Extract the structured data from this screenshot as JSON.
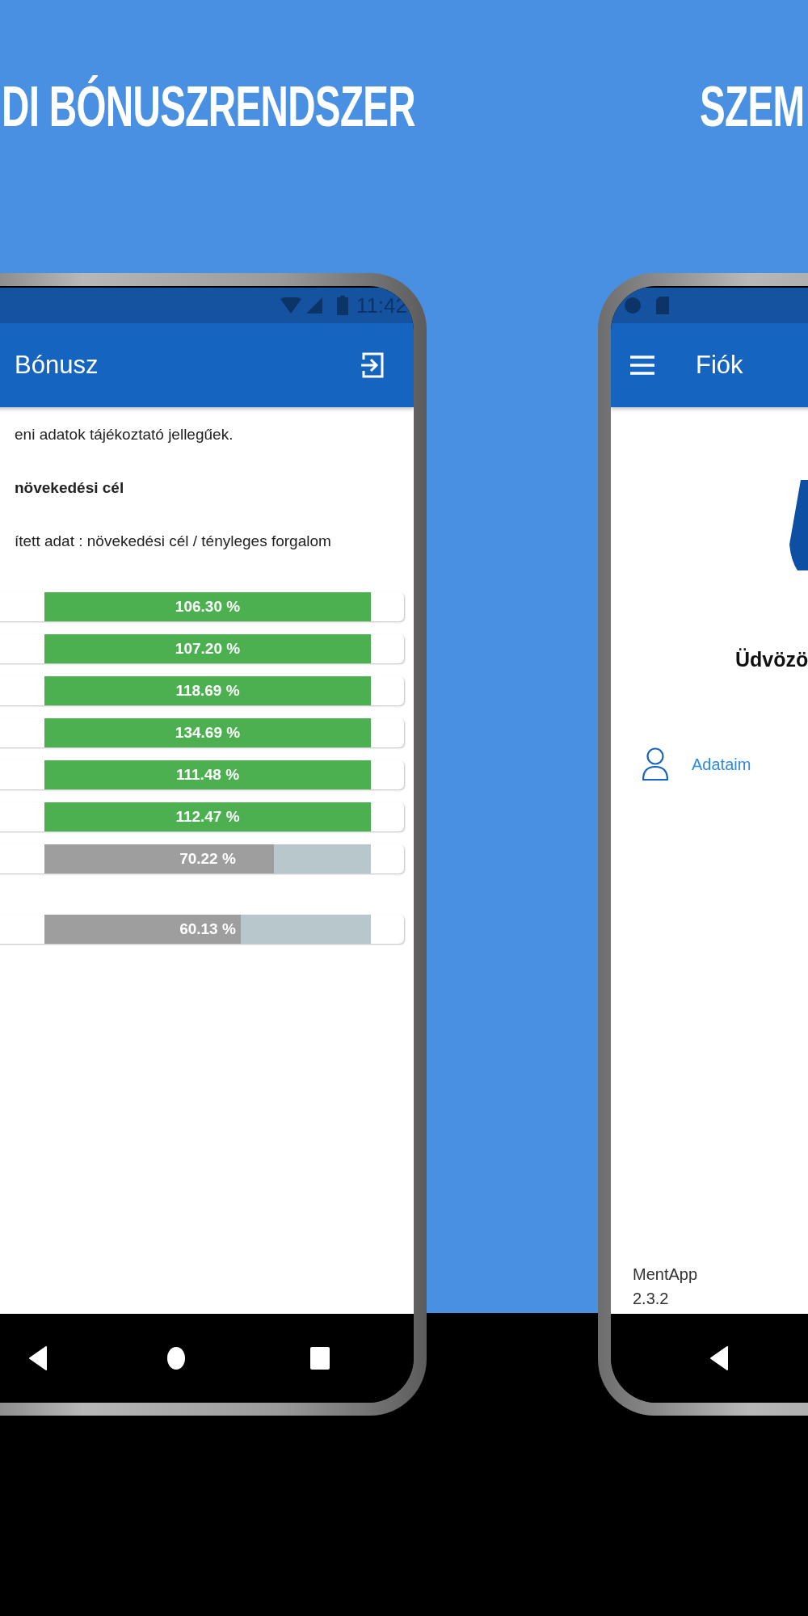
{
  "headline": {
    "left": "DI BÓNUSZRENDSZER",
    "right": "SZEM"
  },
  "phone_left": {
    "status_bar": {
      "time": "11:42"
    },
    "app_bar": {
      "title": "Bónusz"
    },
    "notice": "eni adatok tájékoztató jellegűek.",
    "section_title": "növekedési cél",
    "legend": "ített adat : növekedési cél / tényleges forgalom",
    "groups": [
      {
        "bars": [
          {
            "reading": "106.30 %",
            "level": 1,
            "reached": true
          },
          {
            "reading": "107.20 %",
            "level": 1,
            "reached": true
          },
          {
            "reading": "118.69 %",
            "level": 1,
            "reached": true
          },
          {
            "reading": "134.69 %",
            "level": 1,
            "reached": true
          },
          {
            "reading": "111.48 %",
            "level": 1,
            "reached": true
          },
          {
            "reading": "112.47 %",
            "level": 1,
            "reached": true
          },
          {
            "reading": "70.22 %",
            "level": 0.7022,
            "reached": false
          }
        ]
      },
      {
        "bars": [
          {
            "reading": "60.13 %",
            "level": 0.6013,
            "reached": false
          }
        ]
      }
    ]
  },
  "phone_right": {
    "app_bar": {
      "title": "Fiók"
    },
    "greeting": "Üdvözö",
    "menu": [
      {
        "label": "Adataim"
      }
    ],
    "footer": {
      "app_name": "MentApp",
      "version": "2.3.2"
    }
  }
}
